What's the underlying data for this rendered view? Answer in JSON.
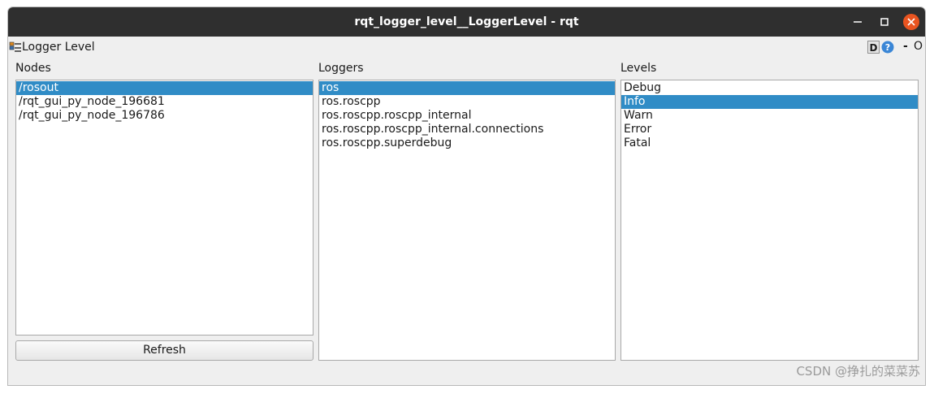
{
  "window": {
    "title": "rqt_logger_level__LoggerLevel - rqt"
  },
  "plugin": {
    "title": "Logger Level",
    "controls": {
      "d_label": "D",
      "help_label": "?",
      "minimize_label": "-",
      "close_label": "O"
    }
  },
  "nodes": {
    "label": "Nodes",
    "items": [
      "/rosout",
      "/rqt_gui_py_node_196681",
      "/rqt_gui_py_node_196786"
    ],
    "selected_index": 0,
    "refresh_label": "Refresh"
  },
  "loggers": {
    "label": "Loggers",
    "items": [
      "ros",
      "ros.roscpp",
      "ros.roscpp.roscpp_internal",
      "ros.roscpp.roscpp_internal.connections",
      "ros.roscpp.superdebug"
    ],
    "selected_index": 0
  },
  "levels": {
    "label": "Levels",
    "items": [
      "Debug",
      "Info",
      "Warn",
      "Error",
      "Fatal"
    ],
    "selected_index": 1
  },
  "watermark": "CSDN @挣扎的菜菜苏",
  "colors": {
    "selection": "#308cc6",
    "titlebar": "#2f2f2f",
    "close_button": "#e95420"
  }
}
